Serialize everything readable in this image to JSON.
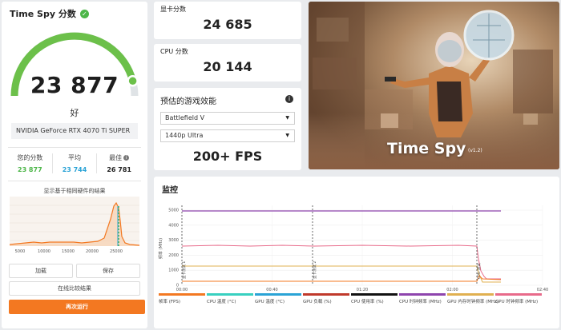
{
  "summary": {
    "title": "Time Spy 分数",
    "score": "23 877",
    "rating": "好",
    "gpu": "NVIDIA GeForce RTX 4070 Ti SUPER",
    "gauge_fraction": 0.92,
    "stats": [
      {
        "label": "您的分数",
        "value": "23 877",
        "color": "#4cb648"
      },
      {
        "label": "平均",
        "value": "23 744",
        "color": "#2aa3d6"
      },
      {
        "label": "最佳",
        "value": "26 781",
        "color": "#222222"
      }
    ],
    "histogram_caption": "显示基于相同硬件的结果",
    "histogram_ticks": [
      "5000",
      "10000",
      "15000",
      "20000",
      "25000"
    ],
    "buttons": {
      "load": "加载",
      "save": "保存",
      "compare": "在线比较结果",
      "run_again": "再次运行"
    }
  },
  "gpu_score": {
    "label": "显卡分数",
    "value": "24 685"
  },
  "cpu_score": {
    "label": "CPU 分数",
    "value": "20 144"
  },
  "game_perf": {
    "title": "预估的游戏效能",
    "game": "Battlefield V",
    "preset": "1440p Ultra",
    "fps": "200+ FPS"
  },
  "hero": {
    "title": "Time Spy",
    "version": "(v1.2)"
  },
  "monitor": {
    "title": "监控",
    "y_label": "频率 (MHz)",
    "y_ticks": [
      "0",
      "1000",
      "2000",
      "3000",
      "4000",
      "5000"
    ],
    "x_ticks": [
      "00:00",
      "00:40",
      "01:20",
      "02:00",
      "02:40"
    ],
    "markers": [
      "显卡测试 1",
      "显卡测试 2",
      "CPU 测试"
    ],
    "legend": [
      {
        "label": "帧率 (FPS)",
        "color": "#f37821"
      },
      {
        "label": "CPU 温度 (°C)",
        "color": "#38d0c0"
      },
      {
        "label": "GPU 温度 (°C)",
        "color": "#2aa3d6"
      },
      {
        "label": "GPU 负载 (%)",
        "color": "#c0392b"
      },
      {
        "label": "CPU 使用率 (%)",
        "color": "#111111"
      },
      {
        "label": "CPU 时钟频率 (MHz)",
        "color": "#8e44ad"
      },
      {
        "label": "GPU 内存时钟频率 (MHz)",
        "color": "#e0b050"
      },
      {
        "label": "GPU 时钟频率 (MHz)",
        "color": "#e86a8a"
      }
    ]
  }
}
